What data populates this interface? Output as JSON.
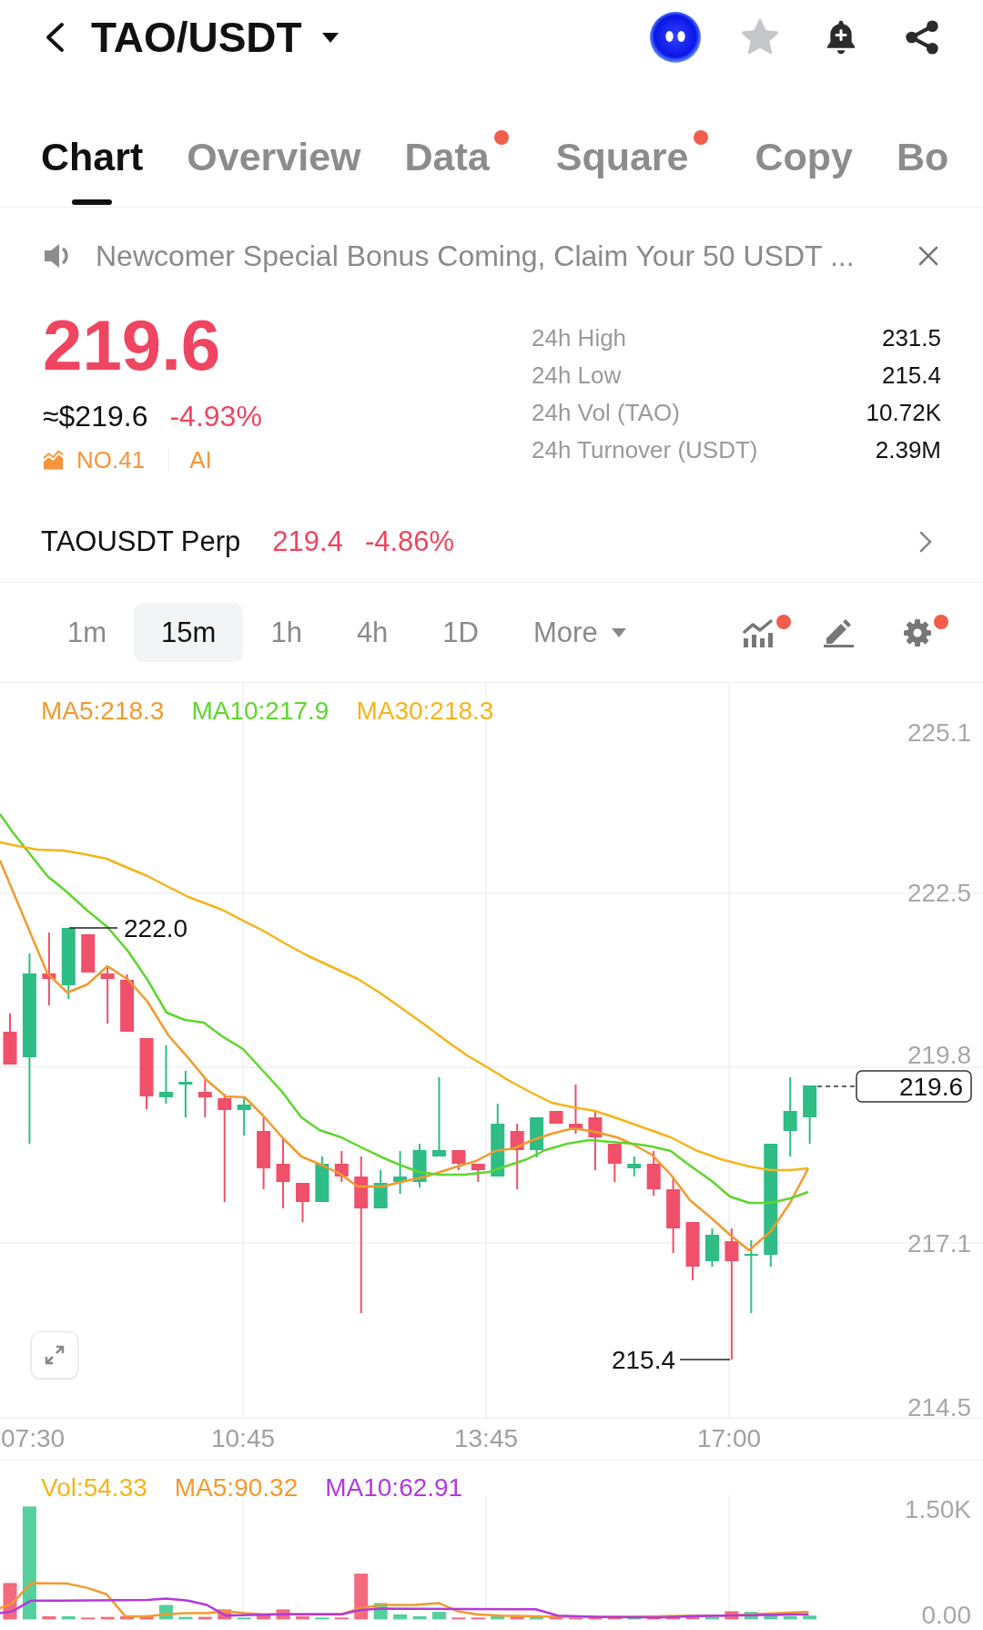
{
  "header": {
    "title": "TAO/USDT"
  },
  "tabs": [
    {
      "label": "Chart",
      "selected": true,
      "dot": false
    },
    {
      "label": "Overview",
      "selected": false,
      "dot": false
    },
    {
      "label": "Data",
      "selected": false,
      "dot": true
    },
    {
      "label": "Square",
      "selected": false,
      "dot": true
    },
    {
      "label": "Copy",
      "selected": false,
      "dot": false
    },
    {
      "label": "Bo",
      "selected": false,
      "dot": false
    }
  ],
  "announcement": {
    "text": "Newcomer Special Bonus Coming, Claim Your 50 USDT ..."
  },
  "ticker": {
    "price": "219.6",
    "fiat_price": "≈$219.6",
    "change": "-4.93%",
    "rank": "NO.41",
    "sector": "AI",
    "stats": [
      {
        "label": "24h High",
        "value": "231.5"
      },
      {
        "label": "24h Low",
        "value": "215.4"
      },
      {
        "label": "24h Vol (TAO)",
        "value": "10.72K"
      },
      {
        "label": "24h Turnover (USDT)",
        "value": "2.39M"
      }
    ]
  },
  "perpetual": {
    "name": "TAOUSDT Perp",
    "price": "219.4",
    "change": "-4.86%"
  },
  "intervals": [
    {
      "label": "1m",
      "selected": false
    },
    {
      "label": "15m",
      "selected": true
    },
    {
      "label": "1h",
      "selected": false
    },
    {
      "label": "4h",
      "selected": false
    },
    {
      "label": "1D",
      "selected": false
    }
  ],
  "more_menu": {
    "label": "More"
  },
  "tools": [
    {
      "kind": "indicators",
      "dot": true
    },
    {
      "kind": "draw",
      "dot": false
    },
    {
      "kind": "settings",
      "dot": true
    }
  ],
  "chart": {
    "legend": [
      {
        "label": "MA5:218.3",
        "color": "#f39a2e"
      },
      {
        "label": "MA10:217.9",
        "color": "#5fd62e"
      },
      {
        "label": "MA30:218.3",
        "color": "#f5b51b"
      }
    ],
    "price_axis": [
      "225.1",
      "222.5",
      "219.8",
      "217.1",
      "214.5"
    ],
    "time_axis": [
      "07:30",
      "10:45",
      "13:45",
      "17:00"
    ],
    "high_label": "222.0",
    "low_label": "215.4",
    "last_price": "219.6"
  },
  "volume": {
    "legend": [
      {
        "label": "Vol:54.33",
        "color": "#f5b51b"
      },
      {
        "label": "MA5:90.32",
        "color": "#f39a2e"
      },
      {
        "label": "MA10:62.91",
        "color": "#b239dc"
      }
    ],
    "axis": [
      "1.50K",
      "0.00"
    ]
  }
}
